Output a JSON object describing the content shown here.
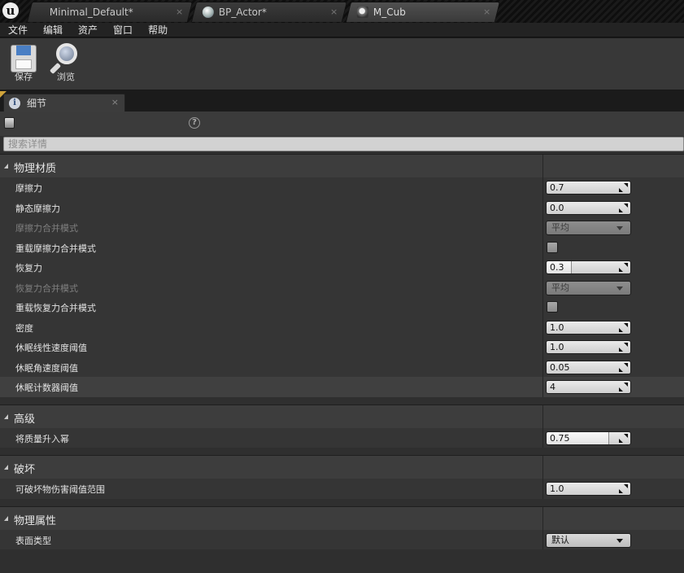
{
  "tabs": [
    {
      "label": "Minimal_Default*"
    },
    {
      "label": "BP_Actor*"
    },
    {
      "label": "M_Cub"
    }
  ],
  "tab_close_glyph": "×",
  "menu": [
    "文件",
    "编辑",
    "资产",
    "窗口",
    "帮助"
  ],
  "toolbar": {
    "save_label": "保存",
    "browse_label": "浏览"
  },
  "details_tab": {
    "label": "细节"
  },
  "help_glyph": "?",
  "search": {
    "placeholder": "搜索详情"
  },
  "categories": [
    {
      "title": "物理材质",
      "props": [
        {
          "name": "摩擦力",
          "kind": "num",
          "value": "0.7"
        },
        {
          "name": "静态摩擦力",
          "kind": "num",
          "value": "0.0"
        },
        {
          "name": "摩擦力合并模式",
          "kind": "combo",
          "value": "平均",
          "disabled": true
        },
        {
          "name": "重载摩擦力合并模式",
          "kind": "check",
          "checked": false
        },
        {
          "name": "恢复力",
          "kind": "num",
          "value": "0.3",
          "fill": 0.3
        },
        {
          "name": "恢复力合并模式",
          "kind": "combo",
          "value": "平均",
          "disabled": true
        },
        {
          "name": "重载恢复力合并模式",
          "kind": "check",
          "checked": false
        },
        {
          "name": "密度",
          "kind": "num",
          "value": "1.0"
        },
        {
          "name": "休眠线性速度阈值",
          "kind": "num",
          "value": "1.0"
        },
        {
          "name": "休眠角速度阈值",
          "kind": "num",
          "value": "0.05"
        },
        {
          "name": "休眠计数器阈值",
          "kind": "num",
          "value": "4",
          "highlight": true
        }
      ]
    },
    {
      "title": "高级",
      "props": [
        {
          "name": "将质量升入幂",
          "kind": "num",
          "value": "0.75",
          "fill": 0.75
        }
      ]
    },
    {
      "title": "破坏",
      "props": [
        {
          "name": "可破坏物伤害阈值范围",
          "kind": "num",
          "value": "1.0"
        }
      ]
    },
    {
      "title": "物理属性",
      "props": [
        {
          "name": "表面类型",
          "kind": "combo",
          "value": "默认",
          "disabled": false
        }
      ]
    }
  ],
  "colors": {
    "accent_corner": "#d1a43a",
    "panel_bg": "#2f2f2f",
    "category_bg": "#3d3d3d"
  },
  "icons": [
    "unreal-logo-icon",
    "save-icon",
    "browse-icon",
    "info-icon",
    "lock-icon",
    "help-icon",
    "grip-icon",
    "chevron-down-icon",
    "expand-arrow-icon"
  ]
}
